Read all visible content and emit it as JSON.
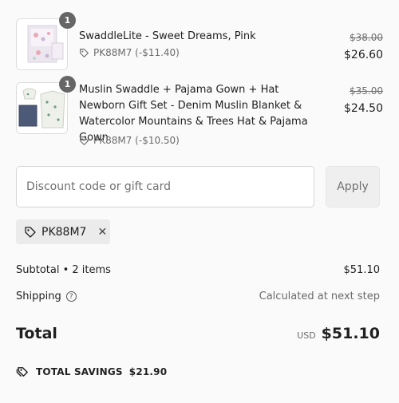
{
  "line_items": [
    {
      "title": "SwaddleLite - Sweet Dreams, Pink",
      "discount_label": "PK88M7 (-$11.40)",
      "original_price": "$38.00",
      "final_price": "$26.60",
      "quantity": "1",
      "icon": "tag-icon"
    },
    {
      "title": "Muslin Swaddle + Pajama Gown + Hat Newborn Gift Set - Denim Muslin Blanket & Watercolor Mountains & Trees Hat & Pajama Gown",
      "discount_label": "PK88M7 (-$10.50)",
      "original_price": "$35.00",
      "final_price": "$24.50",
      "quantity": "1",
      "icon": "tag-icon"
    }
  ],
  "discount_form": {
    "placeholder": "Discount code or gift card",
    "apply_label": "Apply"
  },
  "applied_code": {
    "code": "PK88M7",
    "remove_icon": "close-icon"
  },
  "summary": {
    "subtotal_label": "Subtotal • 2 items",
    "subtotal_value": "$51.10",
    "shipping_label": "Shipping",
    "shipping_value": "Calculated at next step",
    "total_label": "Total",
    "currency": "USD",
    "total_value": "$51.10"
  },
  "savings": {
    "label": "TOTAL SAVINGS",
    "value": "$21.90"
  },
  "colors": {
    "background": "#fafafa",
    "badge": "#666666",
    "chip": "#ebebeb",
    "muted_text": "#6b6b6b"
  }
}
